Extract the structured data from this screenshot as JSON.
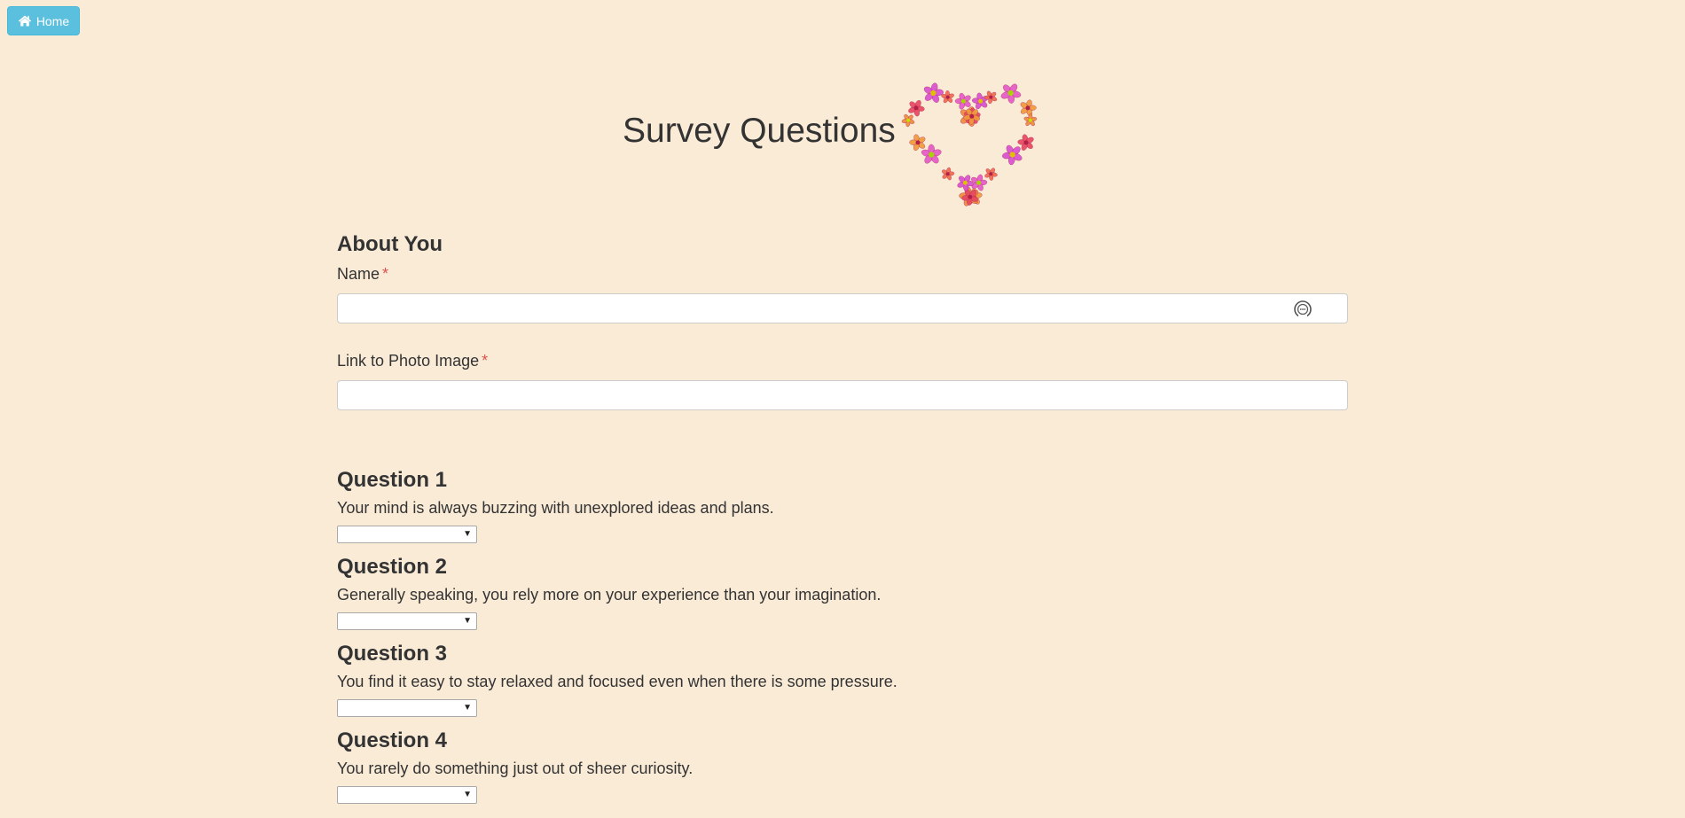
{
  "nav": {
    "home_label": "Home",
    "home_icon": "home-icon"
  },
  "header": {
    "title": "Survey Questions",
    "image": "flower-heart-image"
  },
  "about": {
    "heading": "About You",
    "name_label": "Name",
    "name_value": "",
    "photo_label": "Link to Photo Image",
    "photo_value": "",
    "required_mark": "*",
    "field_icon": "autofill-icon"
  },
  "questions": [
    {
      "heading": "Question 1",
      "text": "Your mind is always buzzing with unexplored ideas and plans.",
      "selected": ""
    },
    {
      "heading": "Question 2",
      "text": "Generally speaking, you rely more on your experience than your imagination.",
      "selected": ""
    },
    {
      "heading": "Question 3",
      "text": "You find it easy to stay relaxed and focused even when there is some pressure.",
      "selected": ""
    },
    {
      "heading": "Question 4",
      "text": "You rarely do something just out of sheer curiosity.",
      "selected": ""
    }
  ],
  "colors": {
    "background": "#faebd7",
    "home_button": "#5bc0de",
    "required": "#d9534f",
    "text": "#333333"
  }
}
